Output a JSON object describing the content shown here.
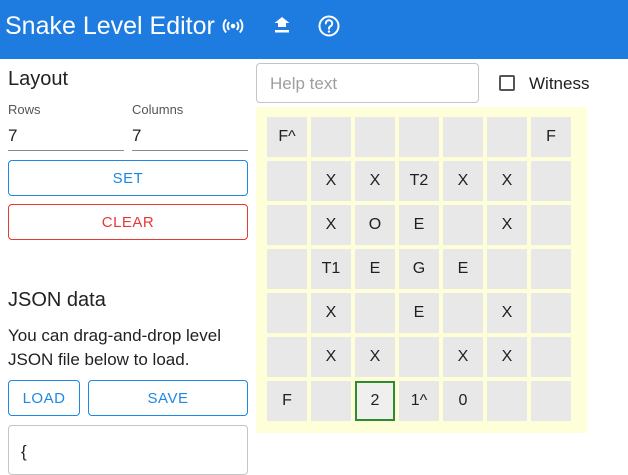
{
  "app": {
    "title": "Snake Level Editor"
  },
  "toolbar": {
    "icons": [
      "broadcast-icon",
      "upload-icon",
      "help-circle-icon"
    ]
  },
  "layout": {
    "heading": "Layout",
    "rows_label": "Rows",
    "rows_value": "7",
    "columns_label": "Columns",
    "columns_value": "7",
    "set_label": "SET",
    "clear_label": "CLEAR"
  },
  "json_section": {
    "heading": "JSON data",
    "line1": "You can drag-and-drop level",
    "line2": "JSON file below to load.",
    "load_label": "LOAD",
    "save_label": "SAVE",
    "textarea_value": "{"
  },
  "help": {
    "placeholder": "Help text"
  },
  "witness": {
    "label": "Witness",
    "checked": false
  },
  "colors": {
    "appbar": "#1e7be0",
    "accent": "#1e88e5",
    "danger": "#e53935",
    "board": "#fefed8",
    "selected": "#2e8b2e"
  },
  "grid": {
    "rows": [
      [
        "F^",
        "",
        "",
        "",
        "",
        "",
        "F"
      ],
      [
        "",
        "X",
        "X",
        "T2",
        "X",
        "X",
        ""
      ],
      [
        "",
        "X",
        "O",
        "E",
        "",
        "X",
        ""
      ],
      [
        "",
        "T1",
        "E",
        "G",
        "E",
        "",
        ""
      ],
      [
        "",
        "X",
        "",
        "E",
        "",
        "X",
        ""
      ],
      [
        "",
        "X",
        "X",
        "",
        "X",
        "X",
        ""
      ],
      [
        "F",
        "",
        "2",
        "1^",
        "0",
        "",
        ""
      ]
    ],
    "selected": [
      6,
      2
    ]
  }
}
